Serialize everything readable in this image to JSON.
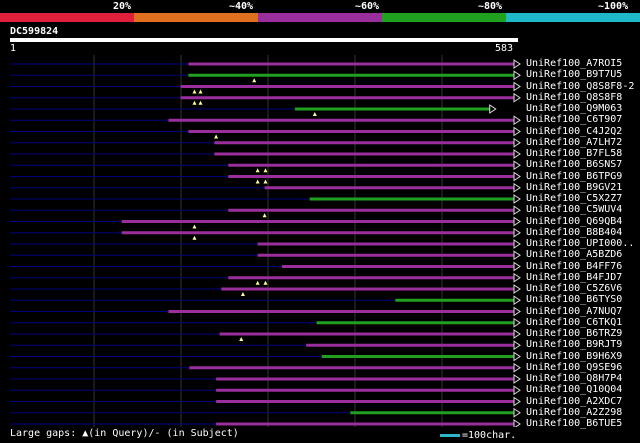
{
  "legend": {
    "labels": [
      "20%",
      "~40%",
      "~60%",
      "~80%",
      "~100%"
    ],
    "colors": [
      "#e0203a",
      "#e07020",
      "#9a2e9c",
      "#1fa01f",
      "#1fb8c8"
    ]
  },
  "query": {
    "id": "DC599824",
    "start": "1",
    "end": "583",
    "length": 583
  },
  "colors": {
    "line": "#000080",
    "magenta": "#9a2e9c",
    "green": "#1fa01f",
    "grid": "#333333",
    "gap": "#ffff99"
  },
  "hits": [
    {
      "label": "UniRef100_A7ROI5",
      "color": "magenta",
      "qs": 207,
      "qe": 583,
      "sgaps": [],
      "qgaps": []
    },
    {
      "label": "UniRef100_B9T7U5",
      "color": "green",
      "qs": 207,
      "qe": 583,
      "sgaps": [],
      "qgaps": [
        283
      ]
    },
    {
      "label": "UniRef100_Q8S8F8-2",
      "color": "magenta",
      "qs": 198,
      "qe": 583,
      "sgaps": [],
      "qgaps": [
        214,
        221
      ]
    },
    {
      "label": "UniRef100_Q8S8F8",
      "color": "magenta",
      "qs": 198,
      "qe": 583,
      "sgaps": [],
      "qgaps": [
        214,
        221
      ]
    },
    {
      "label": "UniRef100_Q9M063",
      "color": "green",
      "qs": 330,
      "qe": 555,
      "sgaps": [],
      "qgaps": [
        353
      ]
    },
    {
      "label": "UniRef100_C6T907",
      "color": "magenta",
      "qs": 184,
      "qe": 583,
      "sgaps": [],
      "qgaps": []
    },
    {
      "label": "UniRef100_C4J2Q2",
      "color": "magenta",
      "qs": 207,
      "qe": 583,
      "sgaps": [],
      "qgaps": [
        239
      ]
    },
    {
      "label": "UniRef100_A7LH72",
      "color": "magenta",
      "qs": 237,
      "qe": 583,
      "sgaps": [],
      "qgaps": []
    },
    {
      "label": "UniRef100_B7FL58",
      "color": "magenta",
      "qs": 237,
      "qe": 583,
      "sgaps": [],
      "qgaps": []
    },
    {
      "label": "UniRef100_B6SNS7",
      "color": "magenta",
      "qs": 253,
      "qe": 583,
      "sgaps": [],
      "qgaps": [
        287,
        296
      ]
    },
    {
      "label": "UniRef100_B6TPG9",
      "color": "magenta",
      "qs": 253,
      "qe": 583,
      "sgaps": [],
      "qgaps": [
        287,
        296
      ]
    },
    {
      "label": "UniRef100_B9GV21",
      "color": "magenta",
      "qs": 295,
      "qe": 583,
      "sgaps": [],
      "qgaps": []
    },
    {
      "label": "UniRef100_C5X2Z7",
      "color": "green",
      "qs": 347,
      "qe": 583,
      "sgaps": [],
      "qgaps": []
    },
    {
      "label": "UniRef100_C5WUV4",
      "color": "magenta",
      "qs": 253,
      "qe": 583,
      "sgaps": [],
      "qgaps": [
        295
      ]
    },
    {
      "label": "UniRef100_Q69QB4",
      "color": "magenta",
      "qs": 130,
      "qe": 583,
      "sgaps": [],
      "qgaps": [
        214
      ]
    },
    {
      "label": "UniRef100_B8B404",
      "color": "magenta",
      "qs": 130,
      "qe": 583,
      "sgaps": [],
      "qgaps": [
        214
      ]
    },
    {
      "label": "UniRef100_UPI000..",
      "color": "magenta",
      "qs": 287,
      "qe": 583,
      "sgaps": [],
      "qgaps": []
    },
    {
      "label": "UniRef100_A5BZD6",
      "color": "magenta",
      "qs": 287,
      "qe": 583,
      "sgaps": [],
      "qgaps": []
    },
    {
      "label": "UniRef100_B4FF76",
      "color": "magenta",
      "qs": 315,
      "qe": 583,
      "sgaps": [],
      "qgaps": []
    },
    {
      "label": "UniRef100_B4FJD7",
      "color": "magenta",
      "qs": 253,
      "qe": 583,
      "sgaps": [],
      "qgaps": [
        287,
        296
      ]
    },
    {
      "label": "UniRef100_C5Z6V6",
      "color": "magenta",
      "qs": 245,
      "qe": 583,
      "sgaps": [],
      "qgaps": [
        270
      ]
    },
    {
      "label": "UniRef100_B6TYS0",
      "color": "green",
      "qs": 446,
      "qe": 583,
      "sgaps": [],
      "qgaps": []
    },
    {
      "label": "UniRef100_A7NUQ7",
      "color": "magenta",
      "qs": 184,
      "qe": 583,
      "sgaps": [],
      "qgaps": []
    },
    {
      "label": "UniRef100_C6TKQ1",
      "color": "green",
      "qs": 355,
      "qe": 583,
      "sgaps": [],
      "qgaps": []
    },
    {
      "label": "UniRef100_B6TRZ9",
      "color": "magenta",
      "qs": 243,
      "qe": 583,
      "sgaps": [],
      "qgaps": [
        268
      ]
    },
    {
      "label": "UniRef100_B9RJT9",
      "color": "magenta",
      "qs": 343,
      "qe": 583,
      "sgaps": [],
      "qgaps": []
    },
    {
      "label": "UniRef100_B9H6X9",
      "color": "green",
      "qs": 361,
      "qe": 583,
      "sgaps": [],
      "qgaps": []
    },
    {
      "label": "UniRef100_Q9SE96",
      "color": "magenta",
      "qs": 208,
      "qe": 583,
      "sgaps": [],
      "qgaps": []
    },
    {
      "label": "UniRef100_Q8H7P4",
      "color": "magenta",
      "qs": 239,
      "qe": 583,
      "sgaps": [],
      "qgaps": []
    },
    {
      "label": "UniRef100_Q10Q04",
      "color": "magenta",
      "qs": 239,
      "qe": 583,
      "sgaps": [],
      "qgaps": []
    },
    {
      "label": "UniRef100_A2XDC7",
      "color": "magenta",
      "qs": 239,
      "qe": 583,
      "sgaps": [],
      "qgaps": []
    },
    {
      "label": "UniRef100_A2Z298",
      "color": "green",
      "qs": 394,
      "qe": 583,
      "sgaps": [],
      "qgaps": []
    },
    {
      "label": "UniRef100_B6TUE5",
      "color": "magenta",
      "qs": 239,
      "qe": 583,
      "sgaps": [],
      "qgaps": []
    }
  ],
  "footer": {
    "large_gaps": "Large gaps: ▲(in Query)/- (in Subject)",
    "scale_label": "=100char."
  }
}
